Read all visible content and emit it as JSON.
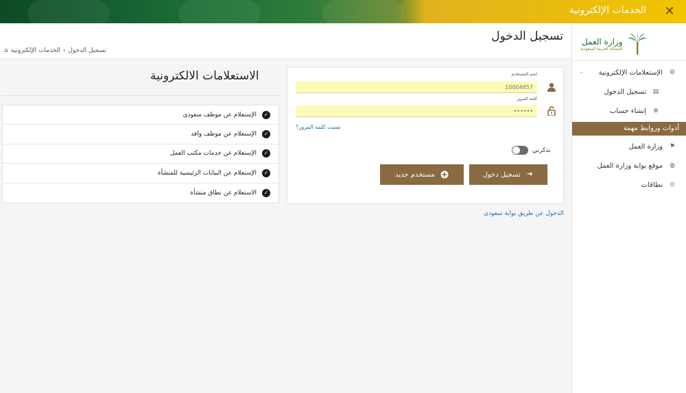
{
  "topbar": {
    "title": "الخدمات الإلكترونية",
    "close_symbol": "✕"
  },
  "header": {
    "page_title": "تسجيل الدخول",
    "breadcrumb": {
      "home": "الخدمات الإلكترونية",
      "separator": "›",
      "current": "تسجيل الدخول"
    }
  },
  "sidebar": {
    "logo": {
      "name": "وزارة العمل",
      "subtitle": "المملكة العربية السعودية"
    },
    "items": [
      {
        "label": "الإستعلامات الإلكترونية",
        "icon": "settings-icon",
        "glyph": "⚙",
        "caret": "⌄"
      },
      {
        "label": "تسجيل الدخول",
        "icon": "login-icon",
        "glyph": "▤"
      },
      {
        "label": "إنشاء حساب",
        "icon": "create-account-icon",
        "glyph": "⊕"
      }
    ],
    "section_label": "أدوات وروابط مهمة",
    "links": [
      {
        "label": "وزارة العمل",
        "icon": "ministry-icon",
        "glyph": "⚑"
      },
      {
        "label": "موقع بوابة وزارة العمل",
        "icon": "globe-icon",
        "glyph": "◍"
      },
      {
        "label": "نطاقات",
        "icon": "nitaqat-icon",
        "glyph": "⊙"
      }
    ]
  },
  "login": {
    "username_label": "اسم المستخدم",
    "username_value": "10004857",
    "password_label": "كلمة المرور",
    "password_value": "••••••",
    "forgot_link": "نسيت كلمة المرور؟",
    "remember_label": "تذكرني",
    "login_button": "تسجيل دخول",
    "new_user_button": "مستخدم جديد",
    "nafath_link": "الدخول عن طريق بوابة سعودي",
    "colors": {
      "accent": "#8a6a40",
      "input_bg": "#fbfbb5",
      "link": "#1e6fb0"
    }
  },
  "inquiries": {
    "title": "الاستعلامات الالكترونية",
    "items": [
      "الإستعلام عن موظف سعودي",
      "الإستعلام عن موظف وافد",
      "الإستعلام عن خدمات مكتب العمل",
      "الإستعلام عن البيانات الرئيسية للمنشأة",
      "الاستعلام عن نطاق منشأة"
    ]
  }
}
